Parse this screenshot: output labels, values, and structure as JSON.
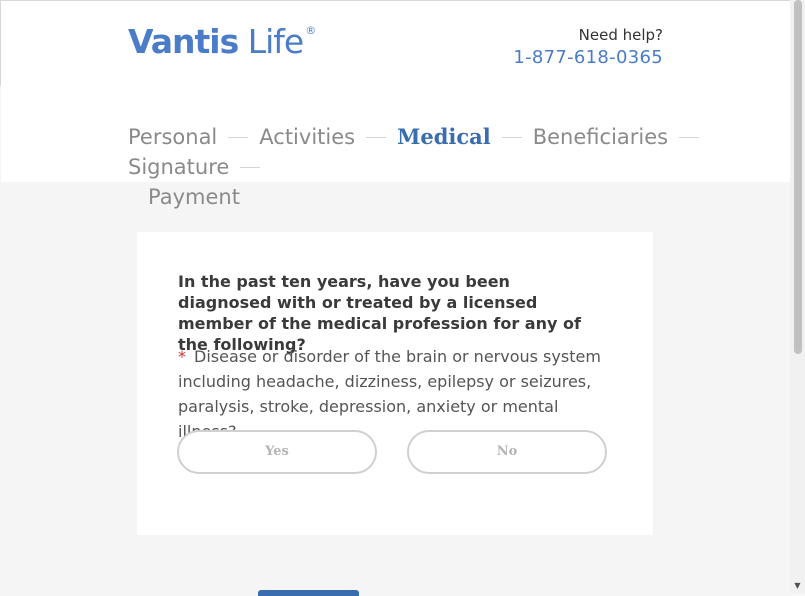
{
  "header": {
    "logo": {
      "bold_text": "Vantis",
      "light_text": "Life",
      "mark": "®"
    },
    "help_label": "Need help?",
    "help_phone": "1-877-618-0365"
  },
  "steps": [
    {
      "label": "Personal",
      "active": false
    },
    {
      "label": "Activities",
      "active": false
    },
    {
      "label": "Medical",
      "active": true
    },
    {
      "label": "Beneficiaries",
      "active": false
    },
    {
      "label": "Signature",
      "active": false
    },
    {
      "label": "Payment",
      "active": false
    }
  ],
  "card": {
    "question": "In the past ten years, have you been diagnosed with or treated by a licensed member of the medical profession for any of the following?",
    "required_mark": "*",
    "detail": "Disease or disorder of the brain or nervous system including headache, dizziness, epilepsy or seizures, paralysis, stroke, depression, anxiety or mental illness?",
    "yes_label": "Yes",
    "no_label": "No"
  },
  "colors": {
    "brand": "#4a7cc7",
    "active_step": "#3a6cb0",
    "required": "#d0342c"
  },
  "icons": {
    "scroll_down": "scroll-down-arrow-icon"
  }
}
